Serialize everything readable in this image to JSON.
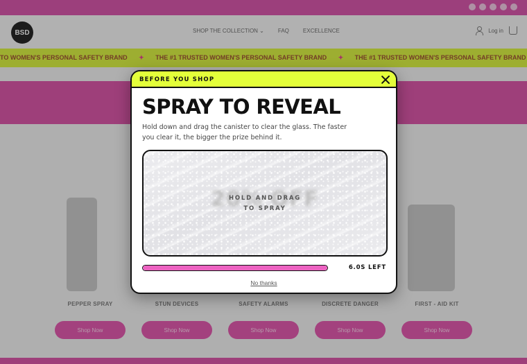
{
  "background": {
    "topbar": {
      "color": "#d84fa8",
      "social_icons": [
        "facebook-icon",
        "instagram-icon",
        "twitter-icon",
        "tiktok-icon",
        "youtube-icon"
      ]
    },
    "header": {
      "logo_text": "BSD",
      "nav": [
        "SHOP THE COLLECTION ⌄",
        "FAQ",
        "EXCELLENCE"
      ],
      "login_label": "Log in"
    },
    "marquee": {
      "items": [
        "TO WOMEN'S PERSONAL SAFETY BRAND",
        "THE #1 TRUSTED WOMEN'S PERSONAL SAFETY BRAND",
        "THE #1 TRUSTED WOMEN'S PERSONAL SAFETY BRAND"
      ],
      "color": "#d9f23a"
    },
    "products": [
      {
        "name": "PEPPER SPRAY",
        "button": "Shop Now"
      },
      {
        "name": "STUN DEVICES",
        "button": "Shop Now"
      },
      {
        "name": "SAFETY ALARMS",
        "button": "Shop Now"
      },
      {
        "name": "DISCRETE DANGER",
        "button": "Shop Now"
      },
      {
        "name": "FIRST - AID KIT",
        "button": "Shop Now"
      }
    ]
  },
  "modal": {
    "eyebrow": "BEFORE YOU SHOP",
    "title": "SPRAY TO REVEAL",
    "description": "Hold down and drag the canister to clear the glass. The faster you clear it, the bigger the prize behind it.",
    "prize_text": "20% OFF",
    "instruction": [
      "HOLD AND DRAG",
      "TO SPRAY"
    ],
    "progress": 1.0,
    "timer": "6.0S LEFT",
    "dismiss_label": "No thanks",
    "accent_color": "#e4ff3a",
    "progress_color": "#ec62c1"
  }
}
